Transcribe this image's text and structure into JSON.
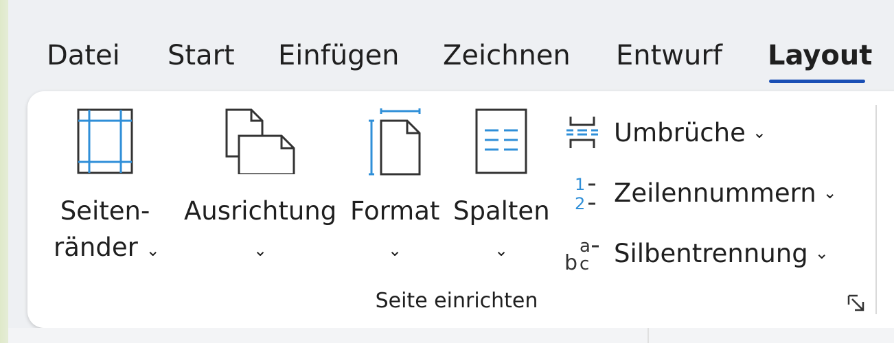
{
  "tabs": [
    "Datei",
    "Start",
    "Einfügen",
    "Zeichnen",
    "Entwurf",
    "Layout"
  ],
  "active_tab": "Layout",
  "ribbon": {
    "buttons": {
      "seitenraender": {
        "line1": "Seiten-",
        "line2": "ränder"
      },
      "ausrichtung": {
        "label": "Ausrichtung"
      },
      "format": {
        "label": "Format"
      },
      "spalten": {
        "label": "Spalten"
      }
    },
    "small_buttons": {
      "umbrueche": "Umbrüche",
      "zeilennummern": "Zeilennummern",
      "silbentrennung": "Silbentrennung"
    },
    "group_label": "Seite einrichten"
  },
  "colors": {
    "accent_blue": "#1a4fb5",
    "icon_blue": "#2f8fd8",
    "icon_dark": "#333333"
  }
}
